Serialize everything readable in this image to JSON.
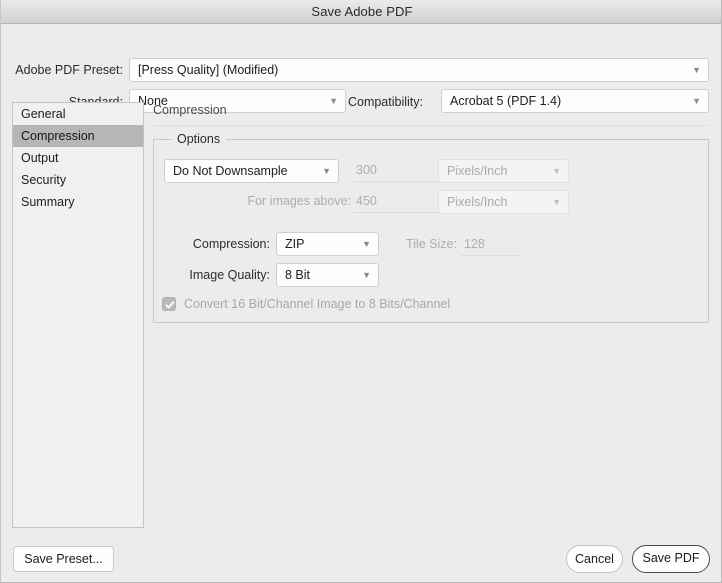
{
  "window": {
    "title": "Save Adobe PDF"
  },
  "top": {
    "preset_label": "Adobe PDF Preset:",
    "preset_value": "[Press Quality] (Modified)",
    "standard_label": "Standard:",
    "standard_value": "None",
    "compatibility_label": "Compatibility:",
    "compatibility_value": "Acrobat 5 (PDF 1.4)"
  },
  "sidebar": {
    "items": [
      {
        "label": "General",
        "selected": false
      },
      {
        "label": "Compression",
        "selected": true
      },
      {
        "label": "Output",
        "selected": false
      },
      {
        "label": "Security",
        "selected": false
      },
      {
        "label": "Summary",
        "selected": false
      }
    ]
  },
  "pane": {
    "title": "Compression",
    "group_legend": "Options",
    "downsample_value": "Do Not Downsample",
    "resolution_value": "300",
    "resolution_unit": "Pixels/Inch",
    "for_images_above_label": "For images above:",
    "for_images_above_value": "450",
    "for_images_above_unit": "Pixels/Inch",
    "compression_label": "Compression:",
    "compression_value": "ZIP",
    "tile_size_label": "Tile Size:",
    "tile_size_value": "128",
    "image_quality_label": "Image Quality:",
    "image_quality_value": "8 Bit",
    "convert_checkbox_label": "Convert 16 Bit/Channel Image to 8 Bits/Channel",
    "convert_checkbox_checked": true
  },
  "footer": {
    "save_preset_label": "Save Preset...",
    "cancel_label": "Cancel",
    "save_pdf_label": "Save PDF"
  },
  "colors": {
    "window_bg": "#ececec",
    "selection": "#b6b6b6",
    "disabled_text": "#adadad",
    "text": "#1d1d1d"
  }
}
